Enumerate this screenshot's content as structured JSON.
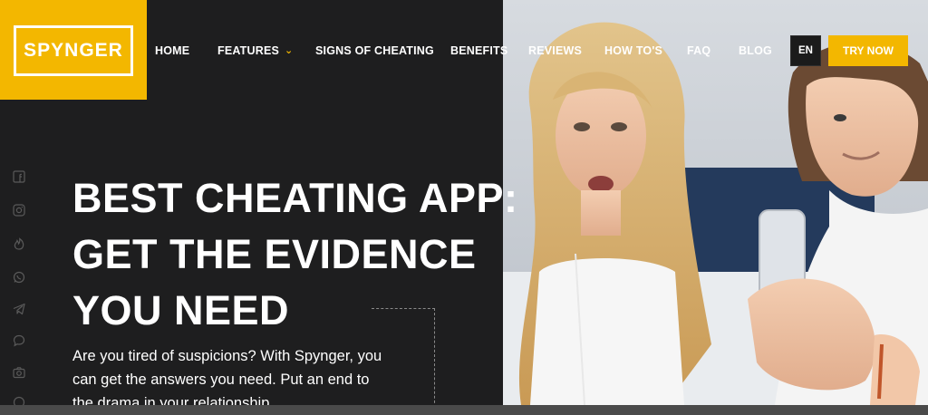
{
  "logo": {
    "text": "SPYNGER"
  },
  "nav": {
    "items": [
      {
        "label": "HOME"
      },
      {
        "label": "FEATURES"
      },
      {
        "label": "SIGNS OF CHEATING"
      },
      {
        "label": "BENEFITS"
      },
      {
        "label": "REVIEWS"
      },
      {
        "label": "HOW TO'S"
      },
      {
        "label": "FAQ"
      },
      {
        "label": "BLOG"
      }
    ],
    "lang": "EN",
    "cta": "TRY NOW"
  },
  "social_icons": [
    "facebook-icon",
    "instagram-icon",
    "tinder-icon",
    "whatsapp-icon",
    "telegram-icon",
    "chat-icon",
    "camera-icon",
    "messenger-icon"
  ],
  "hero": {
    "headline_lines": [
      "BEST CHEATING APP:",
      "GET THE EVIDENCE",
      "YOU NEED"
    ],
    "subtext": "Are you tired of suspicions? With Spynger, you can get the answers you need. Put an end to the drama in your relationship."
  },
  "colors": {
    "accent": "#f3b700",
    "background": "#1e1e1f",
    "text": "#ffffff",
    "icon": "#5a5a5a"
  }
}
